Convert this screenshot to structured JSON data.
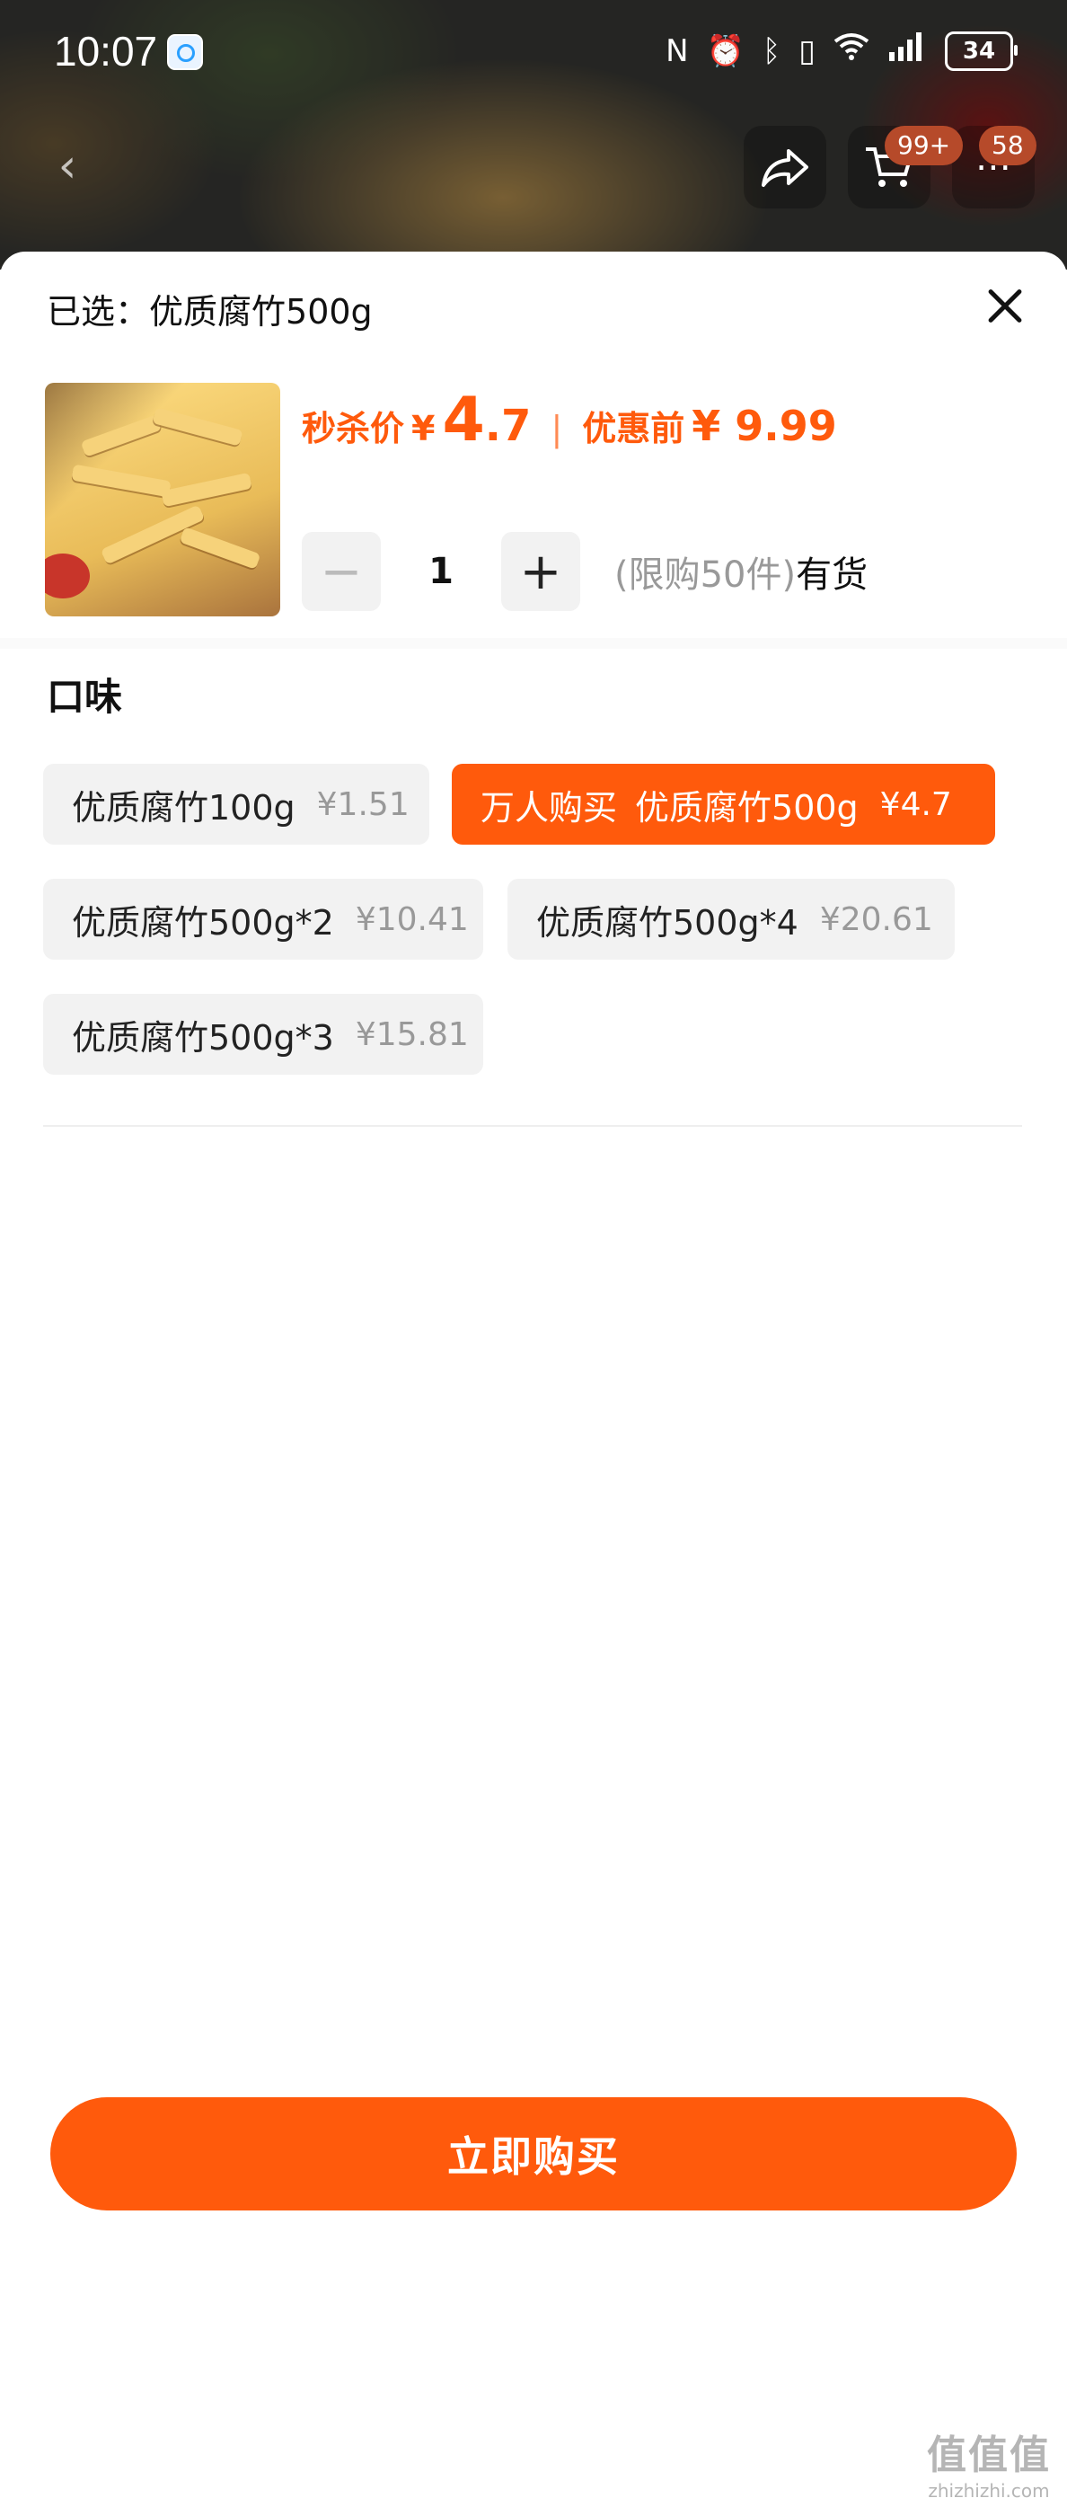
{
  "status_bar": {
    "time": "10:07",
    "icons": [
      "nfc-icon",
      "alarm-icon",
      "bluetooth-icon",
      "vibrate-icon",
      "wifi-icon",
      "signal-4g-icon"
    ],
    "battery": "34"
  },
  "nav": {
    "cart_badge": "99+",
    "message_badge": "58"
  },
  "sheet": {
    "selected_prefix": "已选：",
    "selected_value": "优质腐竹500g",
    "price": {
      "label": "秒杀价",
      "currency": "¥",
      "integer": "4",
      "decimal": ".7",
      "separator": "|",
      "original_label": "优惠前",
      "original_price": "¥ 9.99"
    },
    "quantity": {
      "minus": "−",
      "value": "1",
      "plus": "+",
      "limit": "(限购50件)",
      "stock": "有货"
    },
    "group_title": "口味",
    "options": [
      {
        "label": "优质腐竹100g",
        "price": "¥1.51",
        "selected": false
      },
      {
        "tag": "万人购买",
        "label": "优质腐竹500g",
        "price": "¥4.7",
        "selected": true
      },
      {
        "label": "优质腐竹500g*2",
        "price": "¥10.41",
        "selected": false
      },
      {
        "label": "优质腐竹500g*4",
        "price": "¥20.61",
        "selected": false
      },
      {
        "label": "优质腐竹500g*3",
        "price": "¥15.81",
        "selected": false
      }
    ],
    "buy_button": "立即购买"
  },
  "watermark": {
    "main": "值值值",
    "sub": "zhizhizhi.com"
  },
  "colors": {
    "accent": "#ff5a0c",
    "chip_bg": "#f2f2f2",
    "muted_text": "#999999"
  }
}
